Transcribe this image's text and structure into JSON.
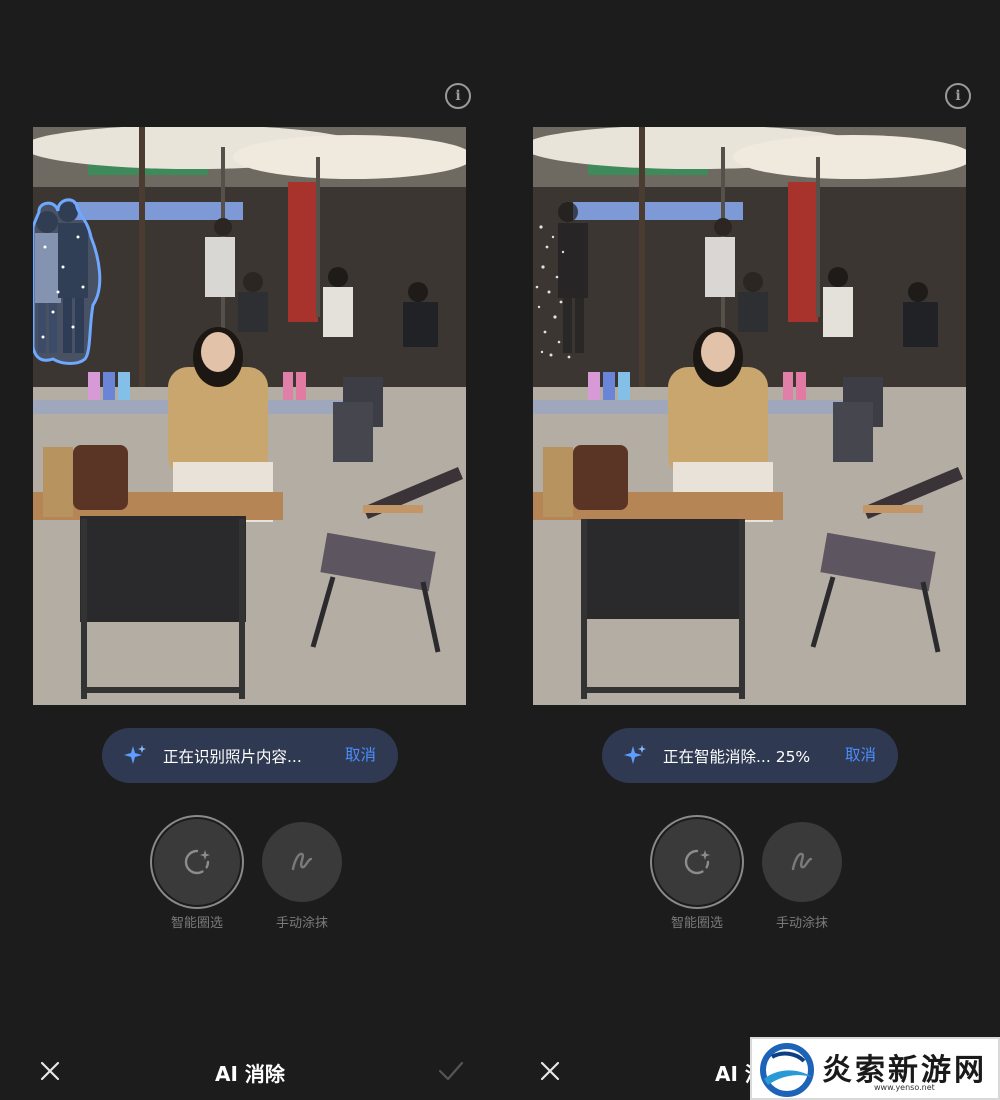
{
  "panels": [
    {
      "progress_text": "正在识别照片内容...",
      "cancel_label": "取消",
      "tools": [
        {
          "label": "智能圈选",
          "icon": "smart-select-icon"
        },
        {
          "label": "手动涂抹",
          "icon": "brush-icon"
        }
      ],
      "title": "AI 消除",
      "icons": {
        "info": "info-icon",
        "close": "close-icon",
        "confirm": "check-icon",
        "sparkle": "sparkle-icon"
      }
    },
    {
      "progress_text": "正在智能消除... 25%",
      "progress_percent": 25,
      "cancel_label": "取消",
      "tools": [
        {
          "label": "智能圈选",
          "icon": "smart-select-icon"
        },
        {
          "label": "手动涂抹",
          "icon": "brush-icon"
        }
      ],
      "title": "AI 消除",
      "icons": {
        "info": "info-icon",
        "close": "close-icon",
        "sparkle": "sparkle-icon"
      }
    }
  ],
  "watermark": {
    "text": "炎索新游网",
    "url": "www.yenso.net"
  },
  "colors": {
    "background": "#1c1c1c",
    "accent": "#4c8dff",
    "pill": "#2f3a52",
    "selection": "#6fa8ff"
  }
}
